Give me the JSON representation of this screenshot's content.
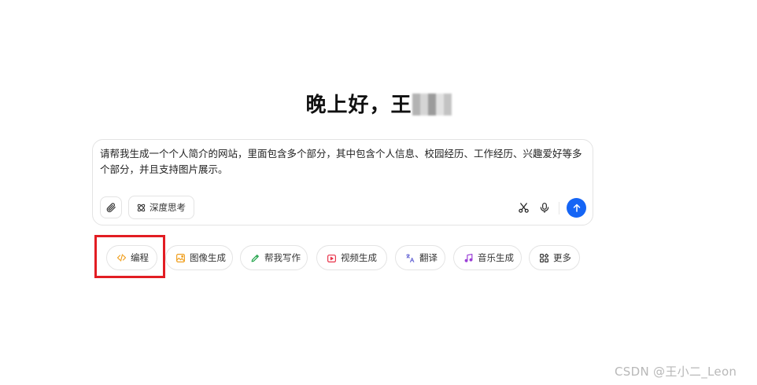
{
  "greeting": {
    "text": "晚上好，王"
  },
  "composer": {
    "text": "请帮我生成一个个人简介的网站，里面包含多个部分，其中包含个人信息、校园经历、工作经历、兴趣爱好等多个部分，并且支持图片展示。",
    "deep_think_label": "深度思考",
    "send_color": "#1565f5"
  },
  "chips": [
    {
      "label": "编程",
      "icon": "code-icon",
      "color": "#f0a020"
    },
    {
      "label": "图像生成",
      "icon": "image-icon",
      "color": "#f0a020"
    },
    {
      "label": "帮我写作",
      "icon": "pen-icon",
      "color": "#22a34a"
    },
    {
      "label": "视频生成",
      "icon": "video-icon",
      "color": "#e8334a"
    },
    {
      "label": "翻译",
      "icon": "translate-icon",
      "color": "#6b6bd6"
    },
    {
      "label": "音乐生成",
      "icon": "music-icon",
      "color": "#9b40d6"
    },
    {
      "label": "更多",
      "icon": "grid-more-icon",
      "color": "#333333"
    }
  ],
  "annotation": {
    "highlight_color": "#e21d23"
  },
  "watermark": "CSDN @王小二_Leon"
}
